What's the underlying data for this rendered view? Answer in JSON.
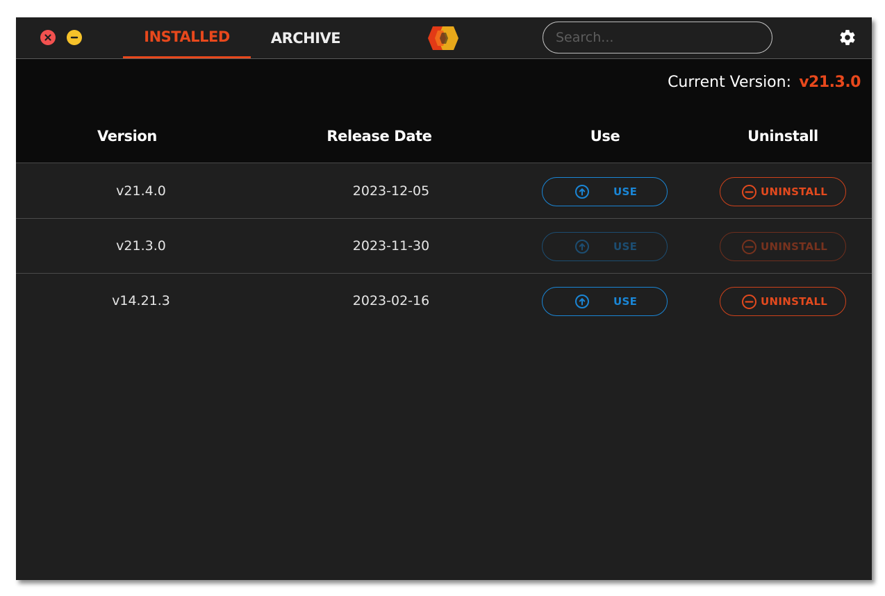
{
  "tabs": {
    "installed": "INSTALLED",
    "archive": "ARCHIVE"
  },
  "search": {
    "placeholder": "Search..."
  },
  "current_version": {
    "label": "Current Version:",
    "value": "v21.3.0"
  },
  "table": {
    "headers": {
      "version": "Version",
      "release_date": "Release Date",
      "use": "Use",
      "uninstall": "Uninstall"
    },
    "rows": [
      {
        "version": "v21.4.0",
        "release_date": "2023-12-05",
        "use_label": "USE",
        "uninstall_label": "UNINSTALL",
        "enabled": true
      },
      {
        "version": "v21.3.0",
        "release_date": "2023-11-30",
        "use_label": "USE",
        "uninstall_label": "UNINSTALL",
        "enabled": false
      },
      {
        "version": "v14.21.3",
        "release_date": "2023-02-16",
        "use_label": "USE",
        "uninstall_label": "UNINSTALL",
        "enabled": true
      }
    ]
  },
  "colors": {
    "accent_orange": "#e8481c",
    "use_blue": "#1a86d6",
    "close_red": "#f2514f",
    "minimize_yellow": "#f6c22a",
    "background": "#1f1f1f",
    "header_background": "#0b0b0b"
  },
  "icons": {
    "close": "close-icon",
    "minimize": "minimize-icon",
    "logo": "hexagon-logo-icon",
    "settings": "gear-icon",
    "use": "arrow-up-circle-icon",
    "uninstall": "minus-circle-icon"
  }
}
